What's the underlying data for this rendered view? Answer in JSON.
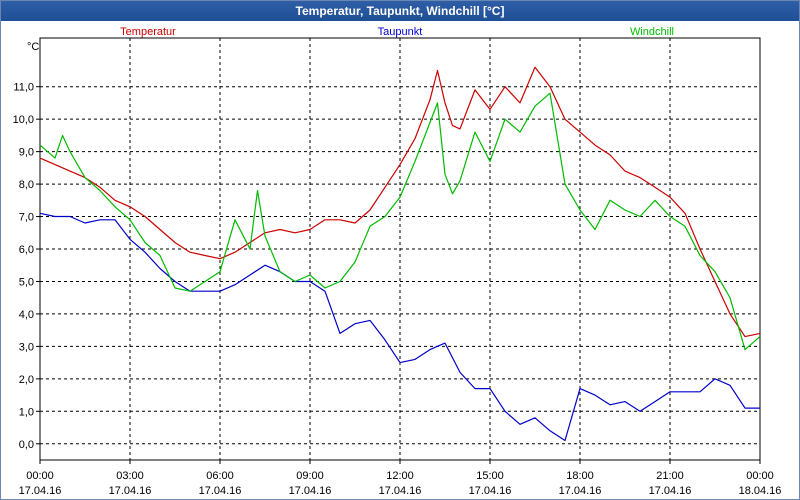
{
  "window": {
    "title": "Temperatur, Taupunkt, Windchill [°C]"
  },
  "chart_data": {
    "type": "line",
    "title": "Temperatur, Taupunkt, Windchill [°C]",
    "ylabel": "°C",
    "ylim": [
      -0.5,
      12.5
    ],
    "y_ticks": [
      "0,0",
      "1,0",
      "2,0",
      "3,0",
      "4,0",
      "5,0",
      "6,0",
      "7,0",
      "8,0",
      "9,0",
      "10,0",
      "11,0"
    ],
    "xlim_hours": [
      0,
      24
    ],
    "x_ticks": [
      {
        "time": "00:00",
        "date": "17.04.16"
      },
      {
        "time": "03:00",
        "date": "17.04.16"
      },
      {
        "time": "06:00",
        "date": "17.04.16"
      },
      {
        "time": "09:00",
        "date": "17.04.16"
      },
      {
        "time": "12:00",
        "date": "17.04.16"
      },
      {
        "time": "15:00",
        "date": "17.04.16"
      },
      {
        "time": "18:00",
        "date": "17.04.16"
      },
      {
        "time": "21:00",
        "date": "17.04.16"
      },
      {
        "time": "00:00",
        "date": "18.04.16"
      }
    ],
    "grid": true,
    "legend_position": "top",
    "series": [
      {
        "name": "Temperatur",
        "color": "#cc0000",
        "x": [
          0,
          0.5,
          1,
          1.5,
          2,
          2.5,
          3,
          3.5,
          4,
          4.5,
          5,
          5.5,
          6,
          6.5,
          7,
          7.5,
          8,
          8.5,
          9,
          9.5,
          10,
          10.5,
          11,
          11.5,
          12,
          12.5,
          13,
          13.25,
          13.5,
          13.75,
          14,
          14.5,
          15,
          15.5,
          16,
          16.5,
          17,
          17.5,
          18,
          18.5,
          19,
          19.5,
          20,
          20.5,
          21,
          21.5,
          22,
          22.5,
          23,
          23.5,
          24
        ],
        "values": [
          8.8,
          8.6,
          8.4,
          8.2,
          7.9,
          7.5,
          7.3,
          7.0,
          6.6,
          6.2,
          5.9,
          5.8,
          5.7,
          5.9,
          6.2,
          6.5,
          6.6,
          6.5,
          6.6,
          6.9,
          6.9,
          6.8,
          7.2,
          7.9,
          8.6,
          9.4,
          10.6,
          11.5,
          10.5,
          9.8,
          9.7,
          10.9,
          10.3,
          11.0,
          10.5,
          11.6,
          11.0,
          10.0,
          9.6,
          9.2,
          8.9,
          8.4,
          8.2,
          7.9,
          7.6,
          7.1,
          6.0,
          5.0,
          4.0,
          3.3,
          3.4
        ]
      },
      {
        "name": "Taupunkt",
        "color": "#0000cc",
        "x": [
          0,
          0.5,
          1,
          1.5,
          2,
          2.5,
          3,
          3.5,
          4,
          4.5,
          5,
          5.5,
          6,
          6.5,
          7,
          7.5,
          8,
          8.5,
          9,
          9.5,
          10,
          10.5,
          11,
          11.5,
          12,
          12.5,
          13,
          13.5,
          14,
          14.5,
          15,
          15.5,
          16,
          16.5,
          17,
          17.5,
          18,
          18.5,
          19,
          19.5,
          20,
          20.5,
          21,
          21.5,
          22,
          22.5,
          23,
          23.5,
          24
        ],
        "values": [
          7.1,
          7.0,
          7.0,
          6.8,
          6.9,
          6.9,
          6.3,
          5.9,
          5.4,
          5.0,
          4.7,
          4.7,
          4.7,
          4.9,
          5.2,
          5.5,
          5.3,
          5.0,
          5.0,
          4.7,
          3.4,
          3.7,
          3.8,
          3.2,
          2.5,
          2.6,
          2.9,
          3.1,
          2.2,
          1.7,
          1.7,
          1.0,
          0.6,
          0.8,
          0.4,
          0.1,
          1.7,
          1.5,
          1.2,
          1.3,
          1.0,
          1.3,
          1.6,
          1.6,
          1.6,
          2.0,
          1.8,
          1.1,
          1.1
        ]
      },
      {
        "name": "Windchill",
        "color": "#00bb00",
        "x": [
          0,
          0.5,
          0.75,
          1,
          1.5,
          2,
          2.5,
          3,
          3.5,
          4,
          4.5,
          5,
          5.5,
          6,
          6.5,
          7,
          7.25,
          7.5,
          8,
          8.5,
          9,
          9.5,
          10,
          10.5,
          11,
          11.5,
          12,
          12.5,
          13,
          13.25,
          13.5,
          13.75,
          14,
          14.5,
          15,
          15.5,
          16,
          16.5,
          17,
          17.5,
          18,
          18.5,
          19,
          19.5,
          20,
          20.5,
          21,
          21.5,
          22,
          22.5,
          23,
          23.5,
          24
        ],
        "values": [
          9.2,
          8.8,
          9.5,
          9.0,
          8.2,
          7.8,
          7.3,
          6.9,
          6.2,
          5.8,
          4.8,
          4.7,
          5.0,
          5.3,
          6.9,
          6.0,
          7.8,
          6.4,
          5.3,
          5.0,
          5.2,
          4.8,
          5.0,
          5.6,
          6.7,
          7.0,
          7.6,
          8.7,
          9.9,
          10.5,
          8.3,
          7.7,
          8.1,
          9.6,
          8.7,
          10.0,
          9.6,
          10.4,
          10.8,
          8.0,
          7.2,
          6.6,
          7.5,
          7.2,
          7.0,
          7.5,
          7.0,
          6.7,
          5.8,
          5.3,
          4.5,
          2.9,
          3.3
        ]
      }
    ]
  }
}
